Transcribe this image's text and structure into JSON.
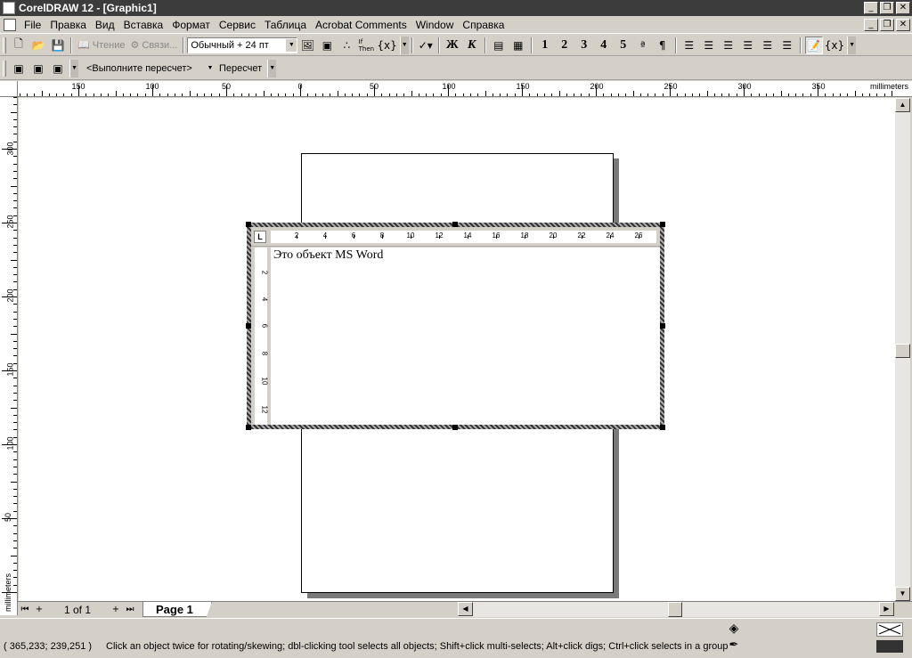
{
  "window": {
    "title": "CorelDRAW 12 - [Graphic1]"
  },
  "menu": [
    "File",
    "Правка",
    "Вид",
    "Вставка",
    "Формат",
    "Сервис",
    "Таблица",
    "Acrobat Comments",
    "Window",
    "Справка"
  ],
  "toolbar1": {
    "read_label": "Чтение",
    "links_label": "Связи...",
    "style_combo": "Обычный + 24 пт",
    "field_code_label": "{x}",
    "bold_label": "Ж",
    "italic_label": "К",
    "heading1": "1",
    "heading2": "2",
    "heading3": "3",
    "heading4": "4",
    "heading5": "5",
    "field_code_label2": "{x}"
  },
  "toolbar2": {
    "recalc_combo": "<Выполните пересчет>",
    "recalc_button": "Пересчет"
  },
  "ruler_top": {
    "labels": [
      "150",
      "100",
      "50",
      "0",
      "50",
      "100",
      "150",
      "200",
      "250",
      "300",
      "350"
    ],
    "unit": "millimeters"
  },
  "ruler_left": {
    "labels": [
      "300",
      "250",
      "200",
      "150",
      "100",
      "50"
    ],
    "unit": "millimeters"
  },
  "word_ruler": {
    "labels": [
      "2",
      "4",
      "6",
      "8",
      "10",
      "12",
      "14",
      "16",
      "18",
      "20",
      "22",
      "24",
      "26"
    ],
    "vlabels": [
      "2",
      "4",
      "6",
      "8",
      "10",
      "12"
    ],
    "tab_selector": "L"
  },
  "word_object": {
    "text": "Это объект MS Word"
  },
  "page_nav": {
    "count": "1 of 1",
    "tab": "Page 1"
  },
  "status": {
    "coords": "( 365,233; 239,251 )",
    "hint": "Click an object twice for rotating/skewing; dbl-clicking tool selects all objects; Shift+click multi-selects; Alt+click digs; Ctrl+click selects in a group"
  }
}
